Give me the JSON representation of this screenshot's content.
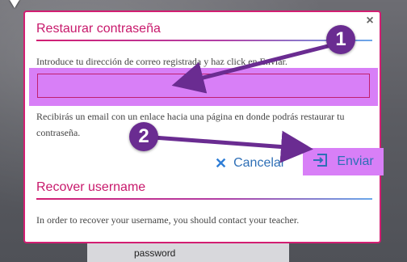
{
  "background": {
    "field_label": "password"
  },
  "modal": {
    "close_symbol": "×",
    "restore_title": "Restaurar contraseña",
    "intro_text": "Introduce tu dirección de correo registrada y haz click en Enviar.",
    "email_value": "",
    "info_text": "Recibirás un email con un enlace hacia una página en donde podrás restaurar tu contraseña.",
    "cancel_label": "Cancelar",
    "send_label": "Enviar",
    "recover_title": "Recover username",
    "recover_text": "In order to recover your username, you should contact your teacher."
  },
  "annotations": {
    "badge_1": "1",
    "badge_2": "2"
  },
  "icons": {
    "close": "close-icon",
    "cancel": "x-icon",
    "send": "send-icon"
  },
  "colors": {
    "accent": "#d21e72",
    "highlight": "#d87ff7",
    "badge": "#6a2c91",
    "button_text": "#2e6fb6"
  }
}
